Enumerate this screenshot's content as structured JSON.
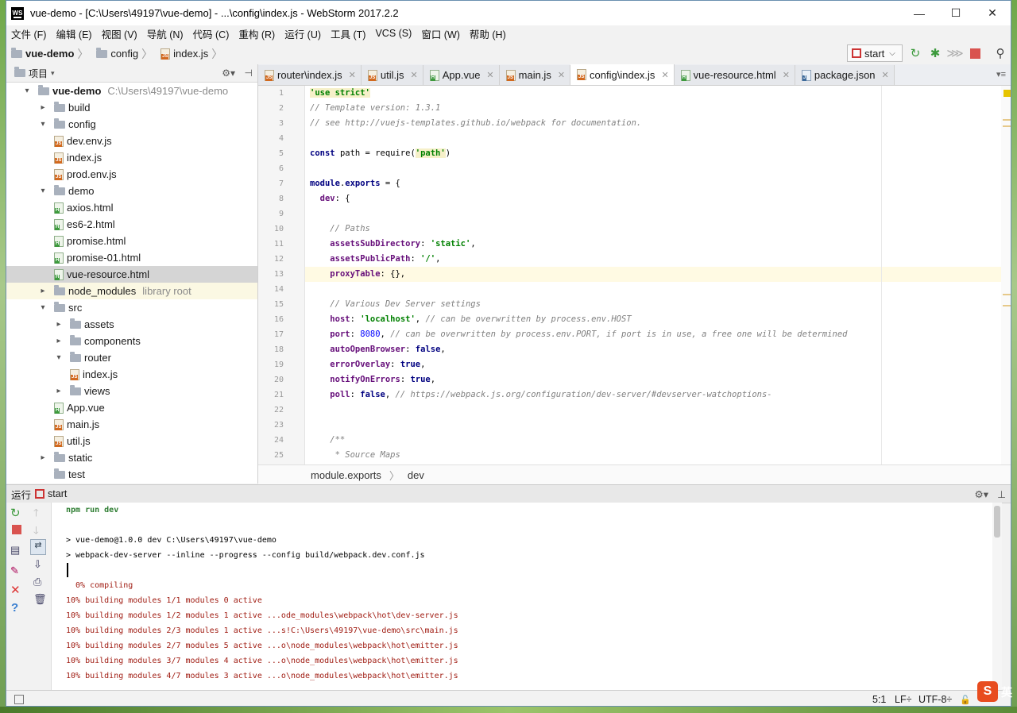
{
  "window": {
    "title": "vue-demo - [C:\\Users\\49197\\vue-demo] - ...\\config\\index.js - WebStorm 2017.2.2",
    "app_icon": "WS",
    "minimize": "—",
    "maximize": "☐",
    "close": "✕"
  },
  "menu": [
    "文件 (F)",
    "编辑 (E)",
    "视图 (V)",
    "导航 (N)",
    "代码 (C)",
    "重构 (R)",
    "运行 (U)",
    "工具 (T)",
    "VCS (S)",
    "窗口 (W)",
    "帮助 (H)"
  ],
  "navbar": {
    "crumbs": [
      "vue-demo",
      "config",
      "index.js"
    ],
    "run_config": "start"
  },
  "project_panel": {
    "title": "项目",
    "tree": [
      {
        "label": "vue-demo",
        "extra": "C:\\Users\\49197\\vue-demo",
        "type": "folder",
        "arrow": "▾",
        "depth": 0
      },
      {
        "label": "build",
        "type": "folder",
        "arrow": "▸",
        "depth": 1
      },
      {
        "label": "config",
        "type": "folder",
        "arrow": "▾",
        "depth": 1
      },
      {
        "label": "dev.env.js",
        "type": "js",
        "depth": 2
      },
      {
        "label": "index.js",
        "type": "js",
        "depth": 2
      },
      {
        "label": "prod.env.js",
        "type": "js",
        "depth": 2
      },
      {
        "label": "demo",
        "type": "folder",
        "arrow": "▾",
        "depth": 1
      },
      {
        "label": "axios.html",
        "type": "html",
        "depth": 2
      },
      {
        "label": "es6-2.html",
        "type": "html",
        "depth": 2
      },
      {
        "label": "promise.html",
        "type": "html",
        "depth": 2
      },
      {
        "label": "promise-01.html",
        "type": "html",
        "depth": 2
      },
      {
        "label": "vue-resource.html",
        "type": "html",
        "depth": 2,
        "selected": true
      },
      {
        "label": "node_modules",
        "extra": "library root",
        "type": "folder",
        "arrow": "▸",
        "depth": 1,
        "highlight": true
      },
      {
        "label": "src",
        "type": "folder",
        "arrow": "▾",
        "depth": 1
      },
      {
        "label": "assets",
        "type": "folder",
        "arrow": "▸",
        "depth": 2
      },
      {
        "label": "components",
        "type": "folder",
        "arrow": "▸",
        "depth": 2
      },
      {
        "label": "router",
        "type": "folder",
        "arrow": "▾",
        "depth": 2
      },
      {
        "label": "index.js",
        "type": "js",
        "depth": 3
      },
      {
        "label": "views",
        "type": "folder",
        "arrow": "▸",
        "depth": 2
      },
      {
        "label": "App.vue",
        "type": "html",
        "depth": 2
      },
      {
        "label": "main.js",
        "type": "js",
        "depth": 2
      },
      {
        "label": "util.js",
        "type": "js",
        "depth": 2
      },
      {
        "label": "static",
        "type": "folder",
        "arrow": "▸",
        "depth": 1
      },
      {
        "label": "test",
        "type": "folder",
        "arrow": "",
        "depth": 1
      }
    ]
  },
  "tabs": [
    {
      "label": "router\\index.js",
      "type": "js"
    },
    {
      "label": "util.js",
      "type": "js"
    },
    {
      "label": "App.vue",
      "type": "html"
    },
    {
      "label": "main.js",
      "type": "js"
    },
    {
      "label": "config\\index.js",
      "type": "js",
      "active": true
    },
    {
      "label": "vue-resource.html",
      "type": "html"
    },
    {
      "label": "package.json",
      "type": "json"
    }
  ],
  "editor": {
    "line_numbers": [
      "1",
      "2",
      "3",
      "4",
      "5",
      "6",
      "7",
      "8",
      "9",
      "10",
      "11",
      "12",
      "13",
      "14",
      "15",
      "16",
      "17",
      "18",
      "19",
      "20",
      "21",
      "22",
      "23",
      "24",
      "25"
    ],
    "current_line": 13,
    "lines": [
      [
        {
          "t": "'use strict'",
          "c": "str hl"
        }
      ],
      [
        {
          "t": "// Template version: 1.3.1",
          "c": "cm"
        }
      ],
      [
        {
          "t": "// see http://vuejs-templates.github.io/webpack for documentation.",
          "c": "cm"
        }
      ],
      [],
      [
        {
          "t": "const ",
          "c": "kw"
        },
        {
          "t": "path = require(",
          "c": ""
        },
        {
          "t": "'path'",
          "c": "str hl"
        },
        {
          "t": ")",
          "c": ""
        }
      ],
      [],
      [
        {
          "t": "module",
          "c": "kw"
        },
        {
          "t": ".",
          "c": ""
        },
        {
          "t": "exports",
          "c": "kw"
        },
        {
          "t": " = {",
          "c": ""
        }
      ],
      [
        {
          "t": "  ",
          "c": ""
        },
        {
          "t": "dev",
          "c": "prop"
        },
        {
          "t": ": {",
          "c": ""
        }
      ],
      [],
      [
        {
          "t": "    // Paths",
          "c": "cm"
        }
      ],
      [
        {
          "t": "    ",
          "c": ""
        },
        {
          "t": "assetsSubDirectory",
          "c": "prop"
        },
        {
          "t": ": ",
          "c": ""
        },
        {
          "t": "'static'",
          "c": "str"
        },
        {
          "t": ",",
          "c": ""
        }
      ],
      [
        {
          "t": "    ",
          "c": ""
        },
        {
          "t": "assetsPublicPath",
          "c": "prop"
        },
        {
          "t": ": ",
          "c": ""
        },
        {
          "t": "'/'",
          "c": "str"
        },
        {
          "t": ",",
          "c": ""
        }
      ],
      [
        {
          "t": "    ",
          "c": ""
        },
        {
          "t": "proxyTable",
          "c": "prop"
        },
        {
          "t": ": {},",
          "c": ""
        }
      ],
      [],
      [
        {
          "t": "    // Various Dev Server settings",
          "c": "cm"
        }
      ],
      [
        {
          "t": "    ",
          "c": ""
        },
        {
          "t": "host",
          "c": "prop"
        },
        {
          "t": ": ",
          "c": ""
        },
        {
          "t": "'localhost'",
          "c": "str"
        },
        {
          "t": ", ",
          "c": ""
        },
        {
          "t": "// can be overwritten by process.env.HOST",
          "c": "cm"
        }
      ],
      [
        {
          "t": "    ",
          "c": ""
        },
        {
          "t": "port",
          "c": "prop"
        },
        {
          "t": ": ",
          "c": ""
        },
        {
          "t": "8080",
          "c": "num"
        },
        {
          "t": ", ",
          "c": ""
        },
        {
          "t": "// can be overwritten by process.env.PORT, if port is in use, a free one will be determined",
          "c": "cm"
        }
      ],
      [
        {
          "t": "    ",
          "c": ""
        },
        {
          "t": "autoOpenBrowser",
          "c": "prop"
        },
        {
          "t": ": ",
          "c": ""
        },
        {
          "t": "false",
          "c": "kw"
        },
        {
          "t": ",",
          "c": ""
        }
      ],
      [
        {
          "t": "    ",
          "c": ""
        },
        {
          "t": "errorOverlay",
          "c": "prop"
        },
        {
          "t": ": ",
          "c": ""
        },
        {
          "t": "true",
          "c": "kw"
        },
        {
          "t": ",",
          "c": ""
        }
      ],
      [
        {
          "t": "    ",
          "c": ""
        },
        {
          "t": "notifyOnErrors",
          "c": "prop"
        },
        {
          "t": ": ",
          "c": ""
        },
        {
          "t": "true",
          "c": "kw"
        },
        {
          "t": ",",
          "c": ""
        }
      ],
      [
        {
          "t": "    ",
          "c": ""
        },
        {
          "t": "poll",
          "c": "prop"
        },
        {
          "t": ": ",
          "c": ""
        },
        {
          "t": "false",
          "c": "kw"
        },
        {
          "t": ", ",
          "c": ""
        },
        {
          "t": "// https://webpack.js.org/configuration/dev-server/#devserver-watchoptions-",
          "c": "cm"
        }
      ],
      [],
      [],
      [
        {
          "t": "    /**",
          "c": "cm"
        }
      ],
      [
        {
          "t": "     * Source Maps",
          "c": "cm"
        }
      ]
    ],
    "breadcrumb": [
      "module.exports",
      "dev"
    ]
  },
  "run_panel": {
    "label": "运行",
    "config": "start",
    "console": [
      {
        "t": "npm run dev",
        "c": "cmd"
      },
      {
        "t": "",
        "c": ""
      },
      {
        "t": "> vue-demo@1.0.0 dev C:\\Users\\49197\\vue-demo",
        "c": ""
      },
      {
        "t": "> webpack-dev-server --inline --progress --config build/webpack.dev.conf.js",
        "c": ""
      },
      {
        "t": "",
        "c": ""
      },
      {
        "t": "  0% compiling",
        "c": "red"
      },
      {
        "t": "10% building modules 1/1 modules 0 active",
        "c": "red"
      },
      {
        "t": "10% building modules 1/2 modules 1 active ...ode_modules\\webpack\\hot\\dev-server.js",
        "c": "red"
      },
      {
        "t": "10% building modules 2/3 modules 1 active ...s!C:\\Users\\49197\\vue-demo\\src\\main.js",
        "c": "red"
      },
      {
        "t": "10% building modules 2/7 modules 5 active ...o\\node_modules\\webpack\\hot\\emitter.js",
        "c": "red"
      },
      {
        "t": "10% building modules 3/7 modules 4 active ...o\\node_modules\\webpack\\hot\\emitter.js",
        "c": "red"
      },
      {
        "t": "10% building modules 4/7 modules 3 active ...o\\node_modules\\webpack\\hot\\emitter.js",
        "c": "red"
      }
    ]
  },
  "statusbar": {
    "position": "5:1",
    "line_sep": "LF÷",
    "encoding": "UTF-8÷",
    "ime": "英",
    "sogou": "S"
  },
  "colors": {
    "accent": "#c33",
    "run_green": "#3c9a3c",
    "selected_row": "#d5d5d5"
  }
}
